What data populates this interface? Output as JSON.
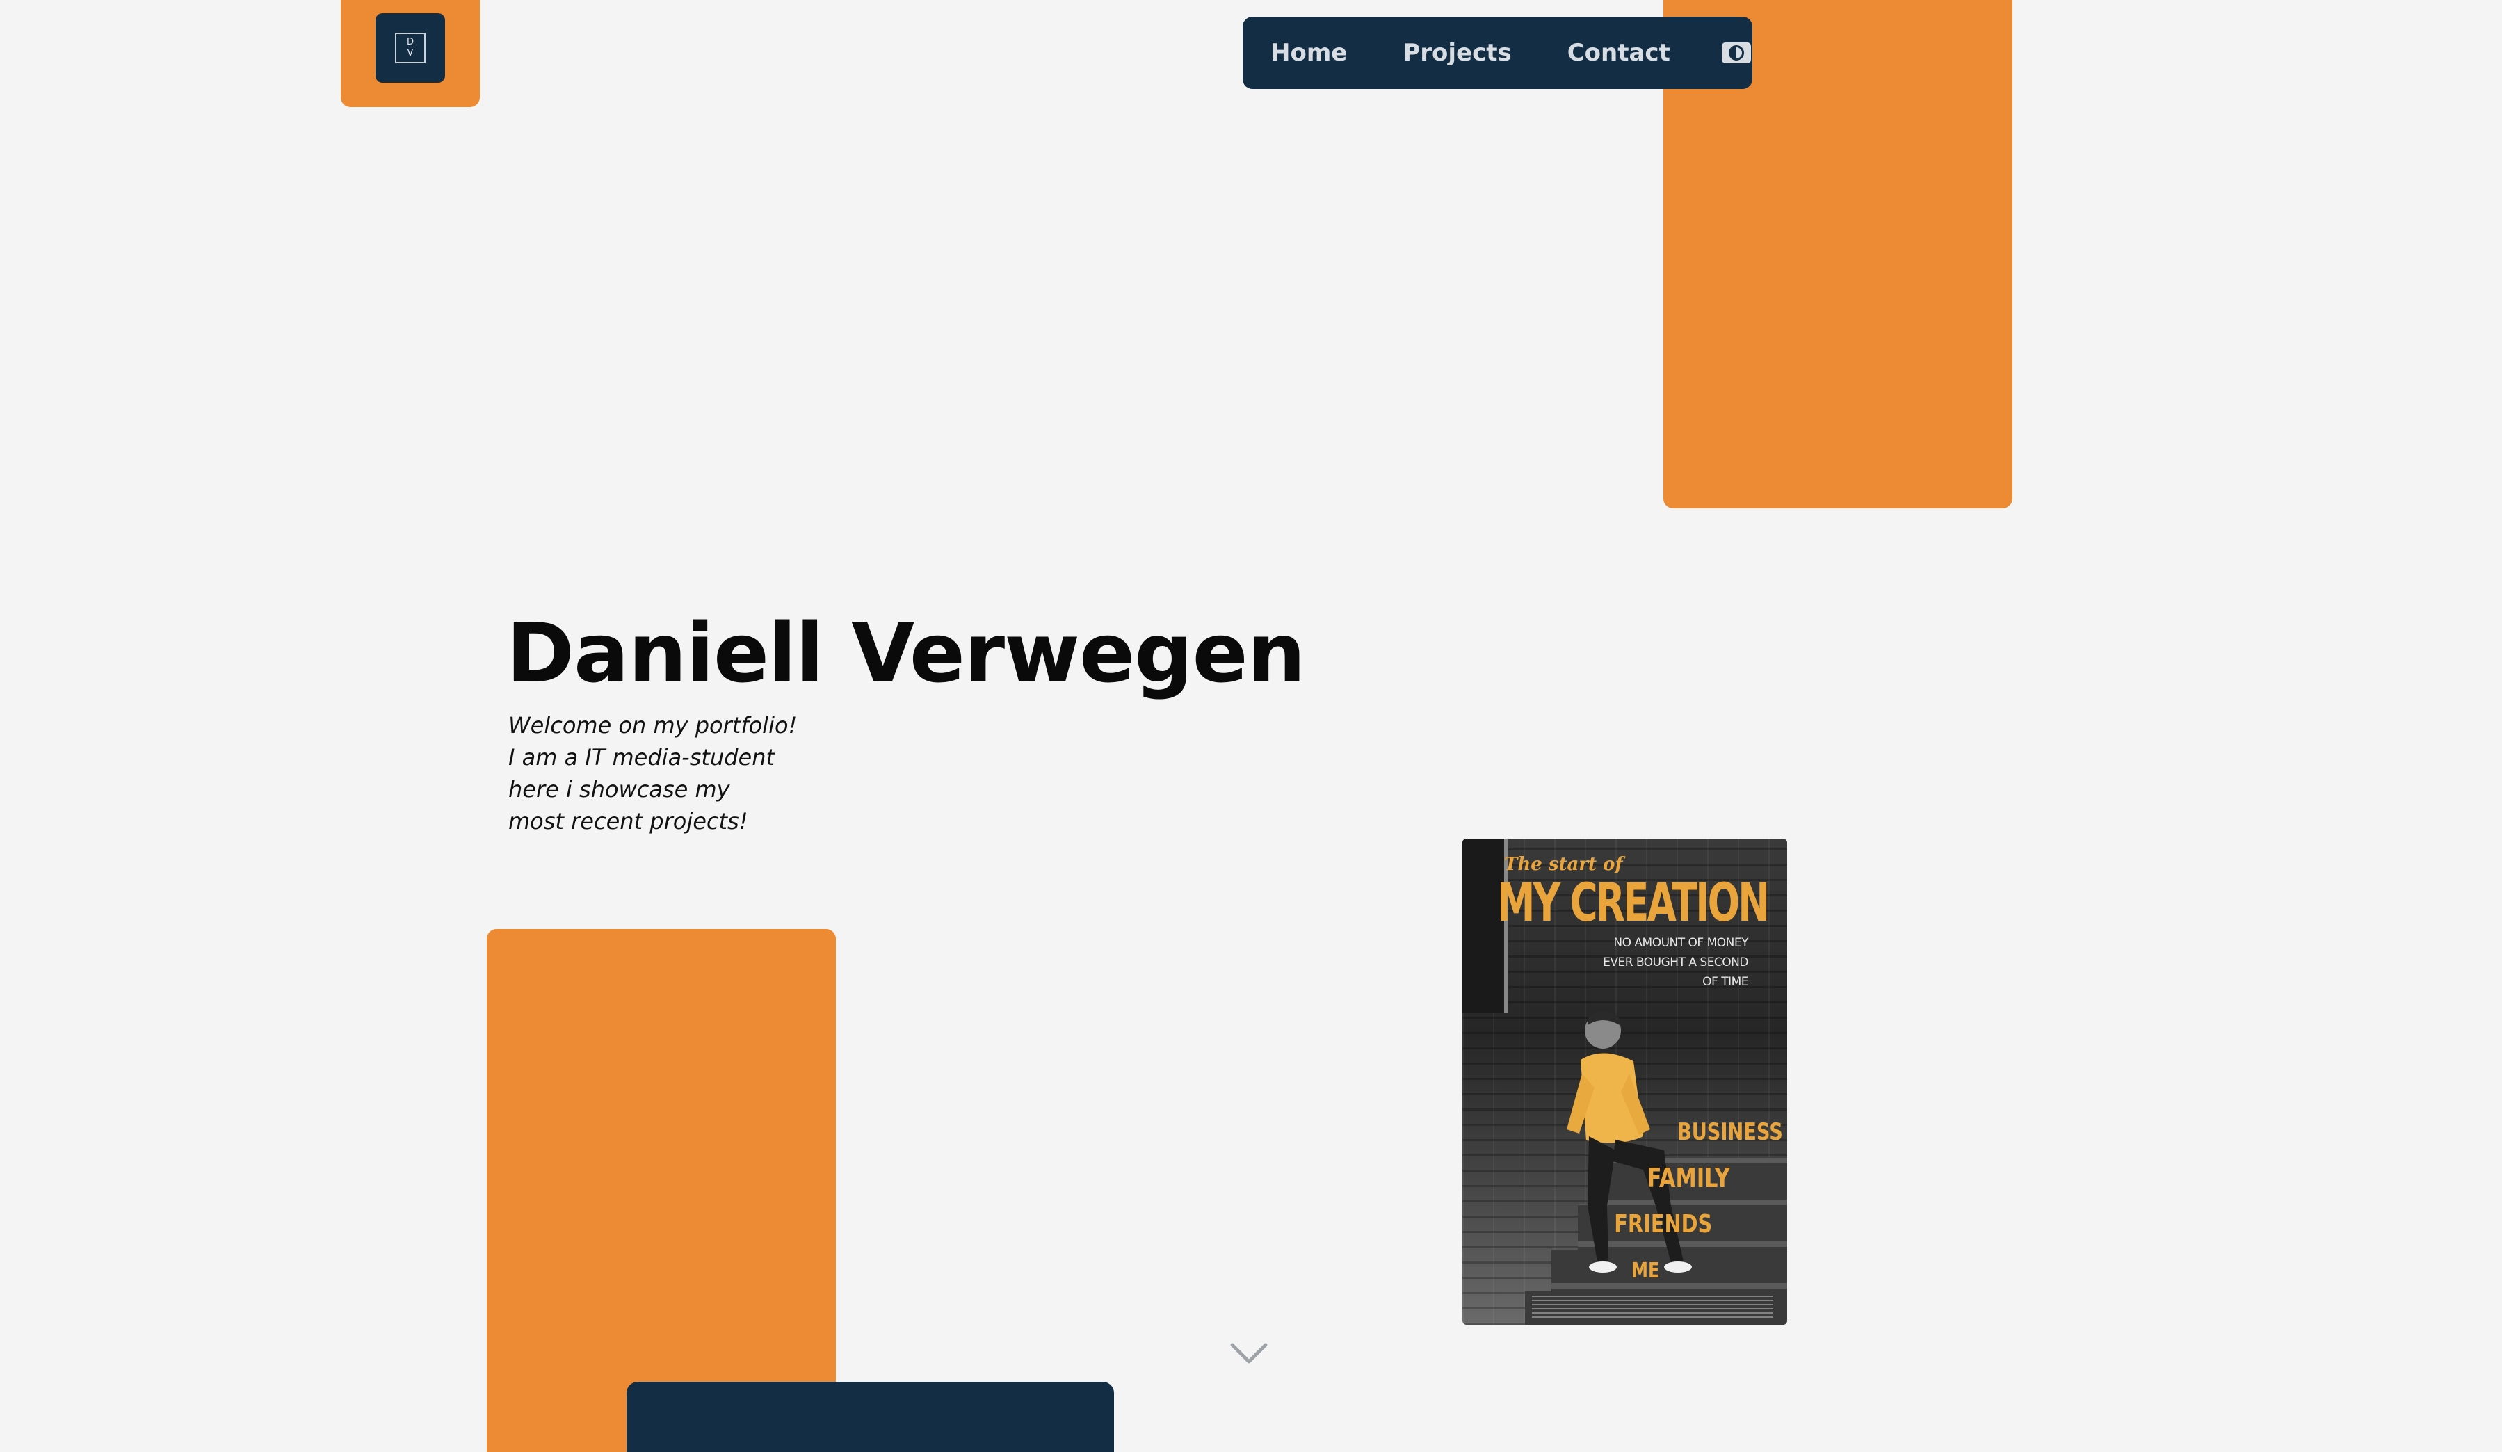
{
  "logo": {
    "text_top": "D",
    "text_bottom": "V"
  },
  "nav": {
    "items": [
      {
        "label": "Home"
      },
      {
        "label": "Projects"
      },
      {
        "label": "Contact"
      }
    ]
  },
  "hero": {
    "title": "Daniell Verwegen",
    "intro_lines": [
      "Welcome on my portfolio!",
      "I am a IT media-student",
      "here i showcase my",
      "most recent projects!"
    ]
  },
  "poster": {
    "kicker": "The start of",
    "headline": "MY CREATION",
    "tagline_lines": [
      "NO AMOUNT OF MONEY",
      "EVER BOUGHT A SECOND",
      "OF TIME"
    ],
    "words": [
      "BUSINESS",
      "FAMILY",
      "FRIENDS",
      "ME"
    ]
  },
  "colors": {
    "background": "#f4f4f4",
    "accent_orange": "#ec8b34",
    "navy": "#132d44",
    "nav_text": "#d7dde3",
    "poster_gold": "#e9a43c"
  },
  "icons": {
    "theme_toggle": "contrast-icon",
    "scroll": "chevron-down-icon"
  }
}
